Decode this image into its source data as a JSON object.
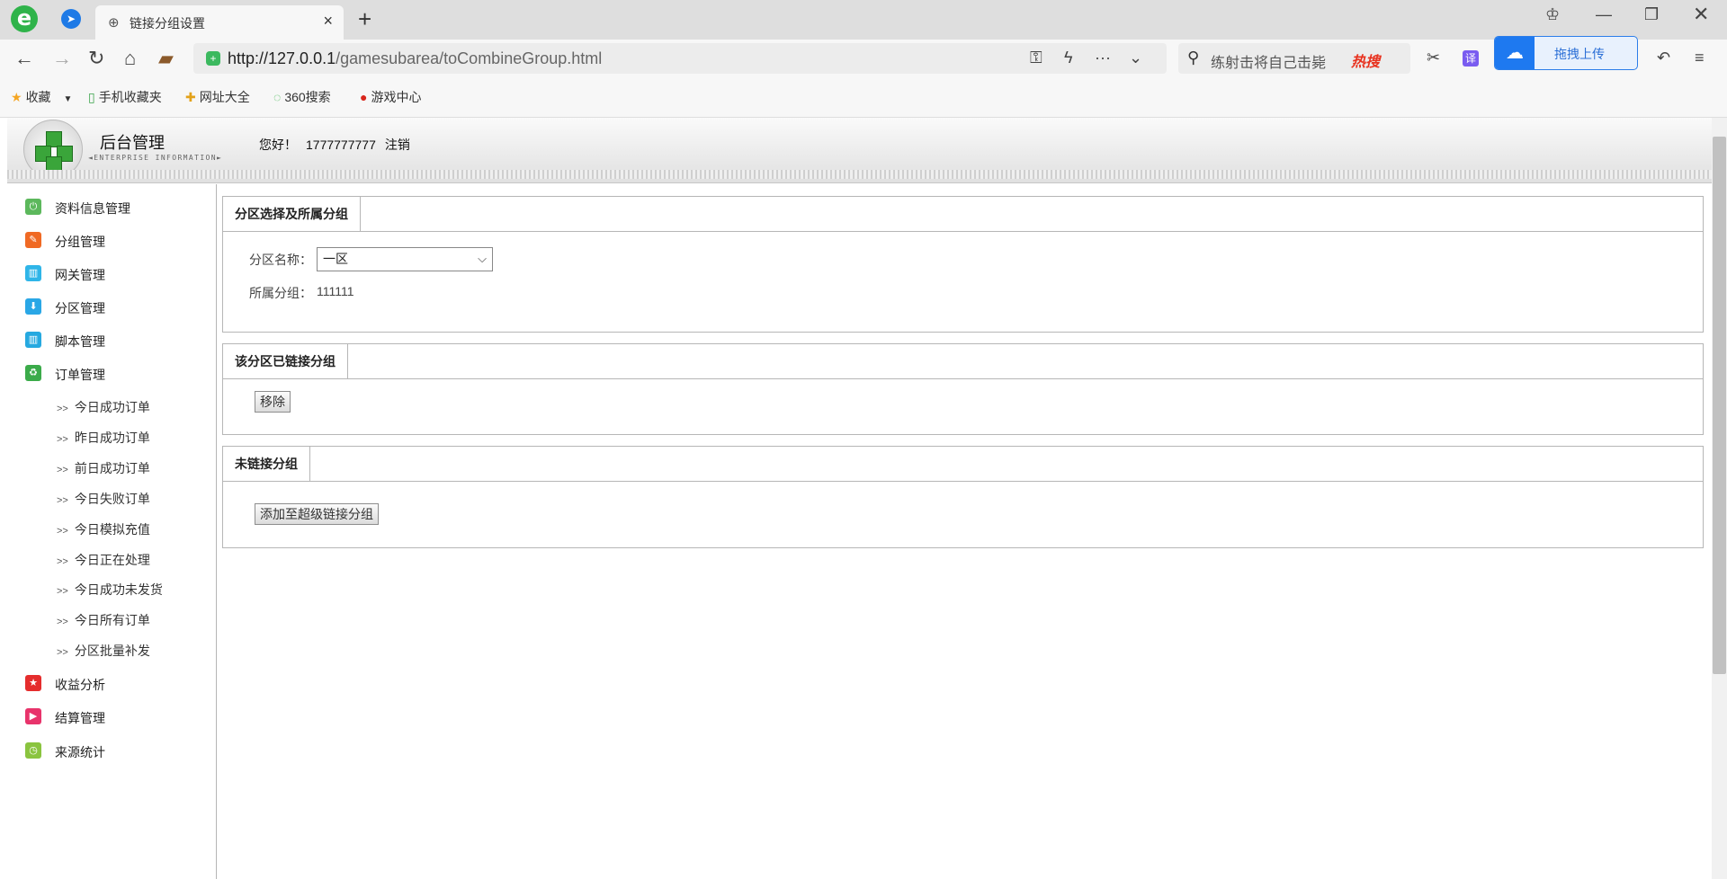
{
  "browser": {
    "tab_title": "链接分组设置",
    "url_host": "http://127.0.0.1",
    "url_path": "/gamesubarea/toCombineGroup.html",
    "search_text": "练射击将自己击毙",
    "search_hot": "热搜",
    "translate_label": "译",
    "upload_label": "拖拽上传",
    "bookmarks": [
      "收藏",
      "手机收藏夹",
      "网址大全",
      "360搜索",
      "游戏中心"
    ]
  },
  "header": {
    "title": "后台管理",
    "subtitle": "◄ENTERPRISE INFORMATION►",
    "greeting": "您好！",
    "username": "1777777777",
    "logout": "注销"
  },
  "sidebar": {
    "items": [
      {
        "label": "资料信息管理",
        "color": "#5cb85c",
        "icon": "power-icon"
      },
      {
        "label": "分组管理",
        "color": "#f06a24",
        "icon": "pencil-icon"
      },
      {
        "label": "网关管理",
        "color": "#2fb5e8",
        "icon": "grid-icon"
      },
      {
        "label": "分区管理",
        "color": "#2aa7e6",
        "icon": "download-icon"
      },
      {
        "label": "脚本管理",
        "color": "#26a9e0",
        "icon": "grid-icon"
      },
      {
        "label": "订单管理",
        "color": "#3bab4a",
        "icon": "recycle-icon"
      }
    ],
    "sub_items": [
      "今日成功订单",
      "昨日成功订单",
      "前日成功订单",
      "今日失败订单",
      "今日模拟充值",
      "今日正在处理",
      "今日成功未发货",
      "今日所有订单",
      "分区批量补发"
    ],
    "bottom_items": [
      {
        "label": "收益分析",
        "color": "#e52d2d",
        "icon": "star-icon"
      },
      {
        "label": "结算管理",
        "color": "#e8336b",
        "icon": "play-icon"
      },
      {
        "label": "来源统计",
        "color": "#8ac43f",
        "icon": "clock-icon"
      }
    ]
  },
  "main": {
    "section1": {
      "title": "分区选择及所属分组",
      "zone_label": "分区名称：",
      "zone_value": "一区",
      "group_label": "所属分组：",
      "group_value": "111111"
    },
    "section2": {
      "title": "该分区已链接分组",
      "remove_button": "移除"
    },
    "section3": {
      "title": "未链接分组",
      "add_button": "添加至超级链接分组"
    }
  }
}
